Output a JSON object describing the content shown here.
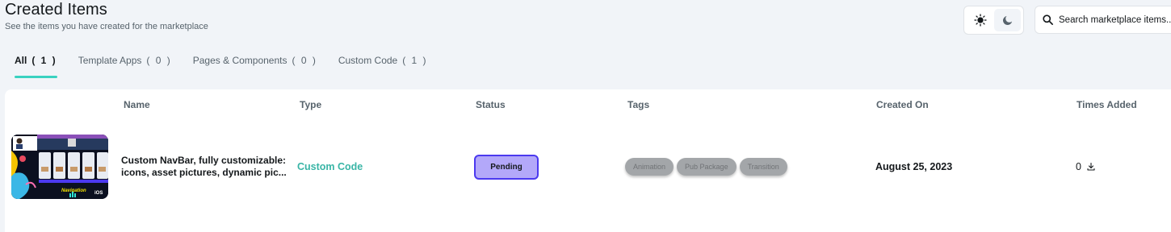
{
  "header": {
    "title": "Created Items",
    "subtitle": "See the items you have created for the marketplace"
  },
  "theme_toggle": {
    "light_icon": "sun-icon",
    "dark_icon": "moon-icon",
    "active": "light"
  },
  "search": {
    "placeholder": "Search marketplace items...",
    "icon": "search-icon"
  },
  "tabs": [
    {
      "label": "All",
      "count": "( 1 )",
      "active": true
    },
    {
      "label": "Template Apps",
      "count": "( 0 )",
      "active": false
    },
    {
      "label": "Pages & Components",
      "count": "( 0 )",
      "active": false
    },
    {
      "label": "Custom Code",
      "count": "( 1 )",
      "active": false
    }
  ],
  "table": {
    "columns": [
      "Name",
      "Type",
      "Status",
      "Tags",
      "Created On",
      "Times Added"
    ],
    "rows": [
      {
        "name_line1": "Custom NavBar, fully customizable:",
        "name_line2": "icons, asset pictures, dynamic pic...",
        "type": "Custom Code",
        "status": "Pending",
        "tags": [
          "Animation",
          "Pub Package",
          "Transition"
        ],
        "created_on": "August 25, 2023",
        "times_added": "0",
        "times_added_icon": "download-icon",
        "thumbnail_texts": [
          "Navigation",
          "iOS"
        ]
      }
    ]
  },
  "colors": {
    "accent": "#39d2c0",
    "type_text": "#39b5a6",
    "status_fill": "#b3a8f9",
    "status_border": "#4b39ef",
    "tag_fill": "#a3a6a9",
    "background": "#f1f4f8"
  }
}
